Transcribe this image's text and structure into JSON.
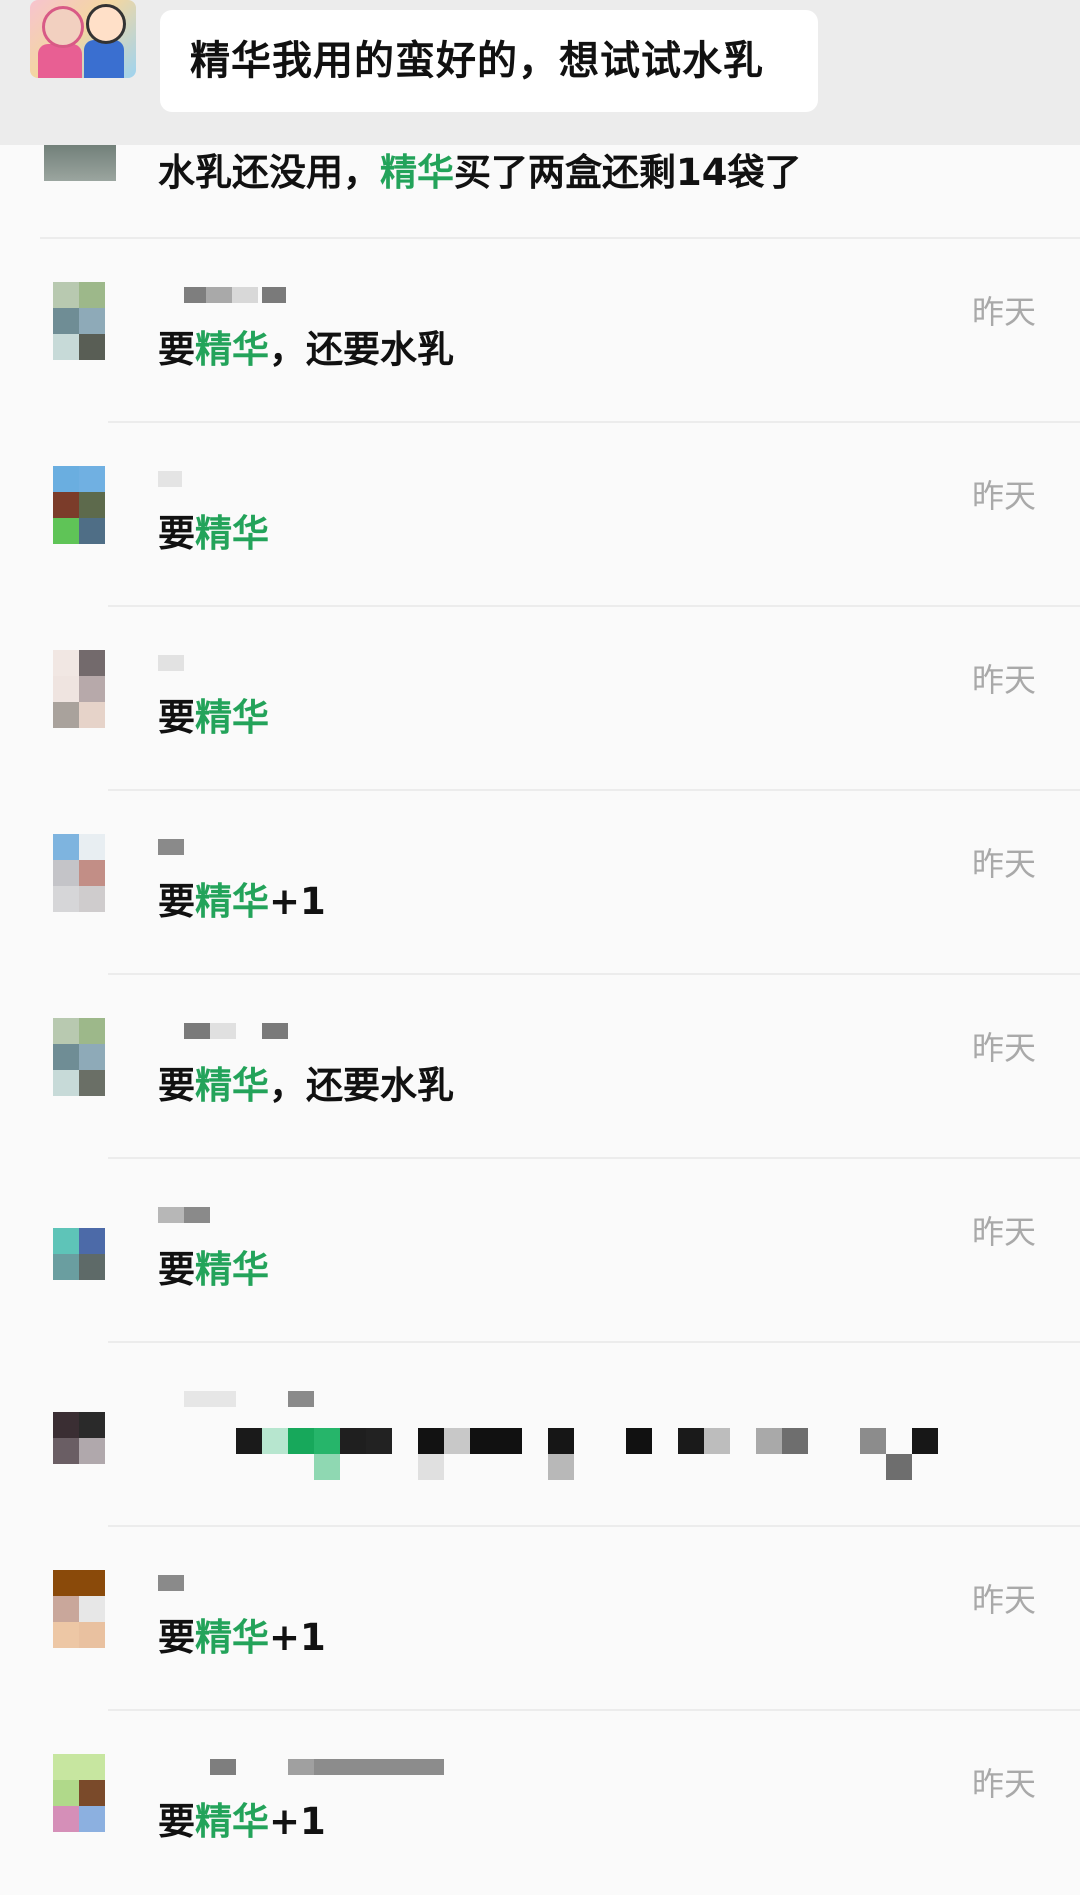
{
  "post": {
    "text": "精华我用的蛮好的，想试试水乳"
  },
  "first_comment": {
    "before": "水乳还没用，",
    "highlight": "精华",
    "after": "买了两盒还剩14袋了"
  },
  "comments": [
    {
      "time": "昨天",
      "before": "要",
      "highlight": "精华",
      "after": "，还要水乳"
    },
    {
      "time": "昨天",
      "before": "要",
      "highlight": "精华",
      "after": ""
    },
    {
      "time": "昨天",
      "before": "要",
      "highlight": "精华",
      "after": ""
    },
    {
      "time": "昨天",
      "before": "要",
      "highlight": "精华",
      "after": "+1"
    },
    {
      "time": "昨天",
      "before": "要",
      "highlight": "精华",
      "after": "，还要水乳"
    },
    {
      "time": "昨天",
      "before": "要",
      "highlight": "精华",
      "after": ""
    },
    {
      "time": "",
      "before": "",
      "highlight": "",
      "after": ""
    },
    {
      "time": "昨天",
      "before": "要",
      "highlight": "精华",
      "after": "+1"
    },
    {
      "time": "昨天",
      "before": "要",
      "highlight": "精华",
      "after": "+1"
    }
  ],
  "colors": {
    "highlight": "#23a35a",
    "timestamp": "#a9a9a9",
    "bubble_bg": "#ffffff",
    "header_bg": "#ececec"
  }
}
